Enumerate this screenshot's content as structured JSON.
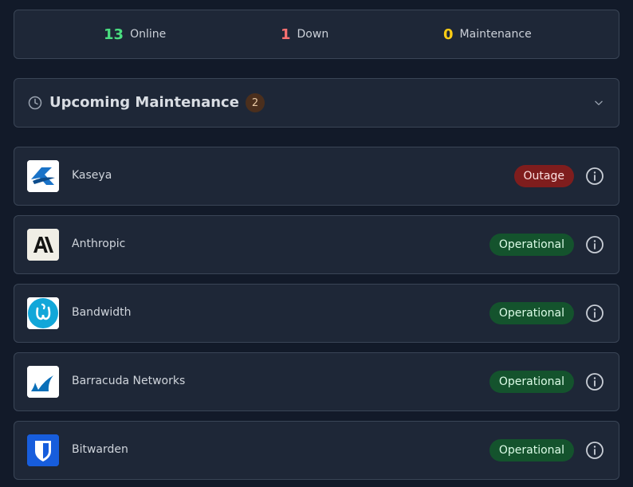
{
  "summary": {
    "online": {
      "count": "13",
      "label": "Online",
      "color": "#4ade80"
    },
    "down": {
      "count": "1",
      "label": "Down",
      "color": "#f87171"
    },
    "maintenance": {
      "count": "0",
      "label": "Maintenance",
      "color": "#facc15"
    }
  },
  "maintenance_section": {
    "title": "Upcoming Maintenance",
    "count": "2",
    "icon": "clock-icon",
    "toggle_icon": "chevron-down-icon"
  },
  "services": [
    {
      "name": "Kaseya",
      "status": "Outage",
      "logo": "kaseya-logo"
    },
    {
      "name": "Anthropic",
      "status": "Operational",
      "logo": "anthropic-logo"
    },
    {
      "name": "Bandwidth",
      "status": "Operational",
      "logo": "bandwidth-logo"
    },
    {
      "name": "Barracuda Networks",
      "status": "Operational",
      "logo": "barracuda-logo"
    },
    {
      "name": "Bitwarden",
      "status": "Operational",
      "logo": "bitwarden-logo"
    }
  ],
  "colors": {
    "background": "#121a29",
    "panel": "#1e2737",
    "outage_badge": "#7f1d1d",
    "operational_badge": "#14532d"
  }
}
